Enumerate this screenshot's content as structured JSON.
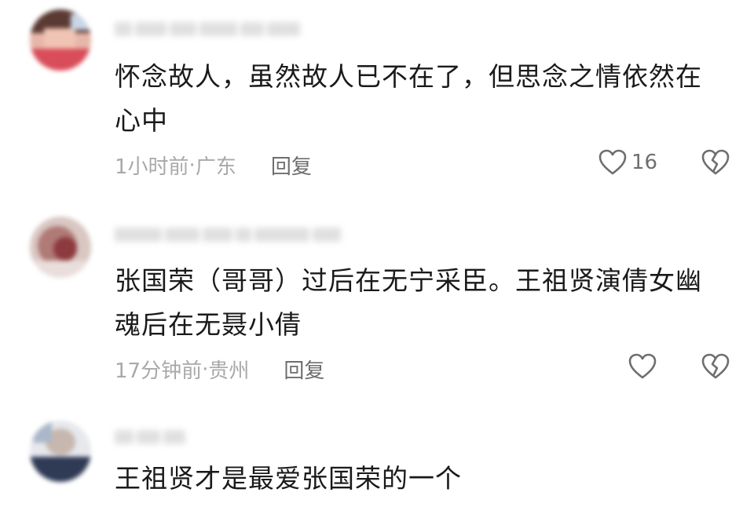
{
  "comments": [
    {
      "text": "怀念故人，虽然故人已不在了，但思念之情依然在心中",
      "time": "1小时前",
      "location": "广东",
      "reply": "回复",
      "likes": "16"
    },
    {
      "text": "张国荣（哥哥）过后在无宁采臣。王祖贤演倩女幽魂后在无聂小倩",
      "time": "17分钟前",
      "location": "贵州",
      "reply": "回复",
      "likes": ""
    },
    {
      "text": "王祖贤才是最爱张国荣的一个"
    }
  ],
  "meta_separator": " · ",
  "icons": [
    "heart-outline-icon",
    "broken-heart-icon"
  ]
}
